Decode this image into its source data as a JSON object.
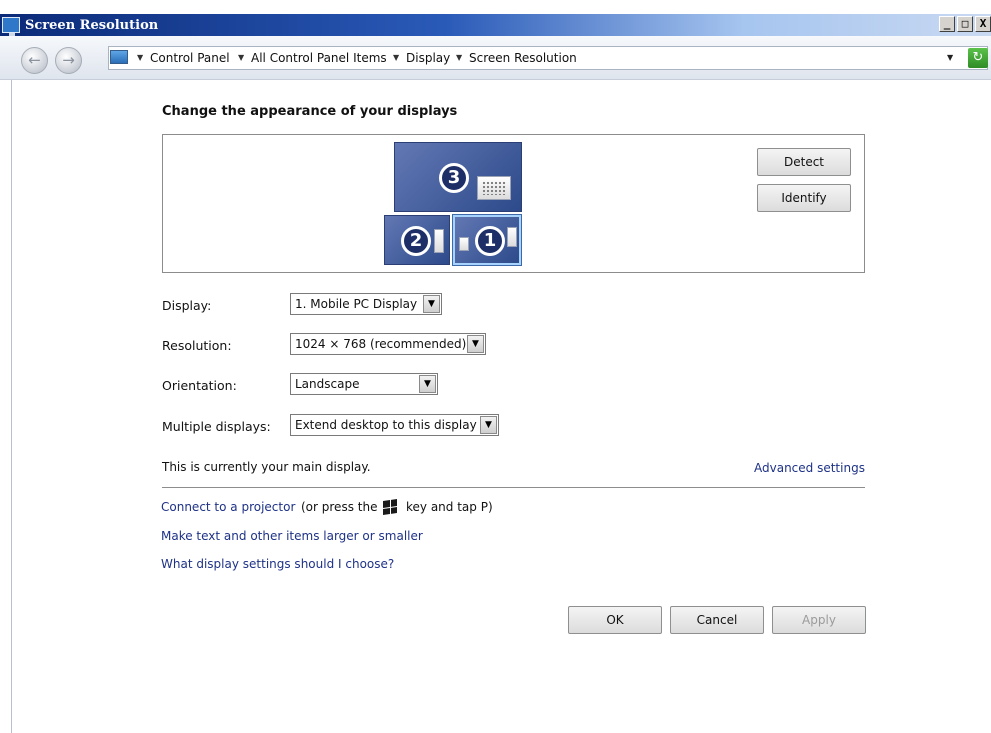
{
  "window": {
    "title": "Screen Resolution",
    "controls": {
      "minimize": "_",
      "maximize": "□",
      "close": "X"
    }
  },
  "address_bar": {
    "breadcrumbs": [
      "Control Panel",
      "All Control Panel Items",
      "Display",
      "Screen Resolution"
    ],
    "icons": {
      "back": "back-arrow-icon",
      "forward": "forward-arrow-icon",
      "location": "control-panel-icon",
      "refresh": "refresh-icon"
    }
  },
  "main": {
    "heading": "Change the appearance of your displays",
    "preview": {
      "monitors": [
        {
          "number": "3"
        },
        {
          "number": "2"
        },
        {
          "number": "1"
        }
      ],
      "detect_label": "Detect",
      "identify_label": "Identify"
    },
    "form": {
      "display": {
        "label": "Display:",
        "value": "1. Mobile PC Display"
      },
      "resolution": {
        "label": "Resolution:",
        "value": "1024 × 768 (recommended)"
      },
      "orientation": {
        "label": "Orientation:",
        "value": "Landscape"
      },
      "multiple_displays": {
        "label": "Multiple displays:",
        "value": "Extend desktop to this display"
      }
    },
    "main_display_text": "This is currently your main display.",
    "advanced_settings": "Advanced settings",
    "projector": {
      "link": "Connect to a projector",
      "suffix_before_icon": "(or press the",
      "suffix_after_icon": "key and tap P)"
    },
    "text_size_link": "Make text and other items larger or smaller",
    "help_link": "What display settings should I choose?",
    "buttons": {
      "ok": "OK",
      "cancel": "Cancel",
      "apply": "Apply"
    }
  },
  "colors": {
    "link": "#1e3287",
    "title_bar": "#0b2a78",
    "monitor": "#3d5595"
  }
}
